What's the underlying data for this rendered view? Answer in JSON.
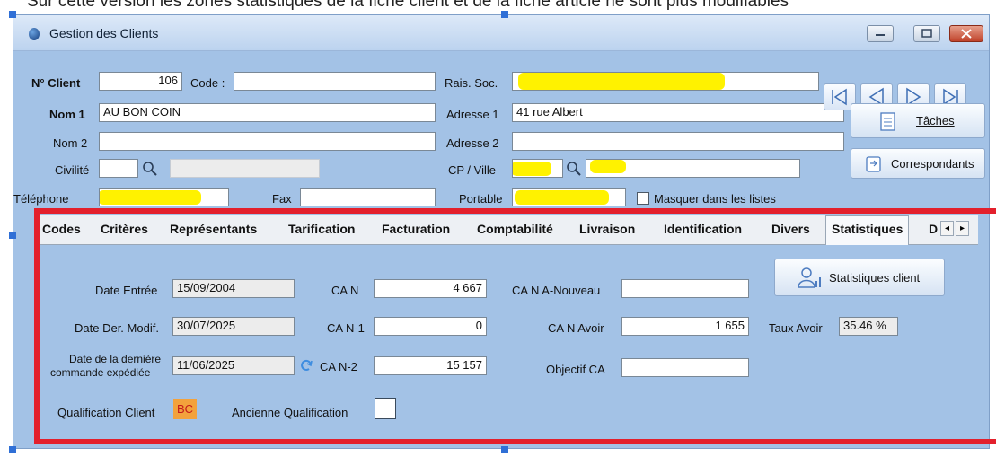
{
  "top_caption": "Sur cette version les zones statistiques de la fiche client et de la fiche article ne sont plus modifiables",
  "window": {
    "title": "Gestion des Clients",
    "buttons": [
      "minimize",
      "maximize",
      "close"
    ]
  },
  "client": {
    "num_label": "N° Client",
    "num_value": "106",
    "code_label": "Code :",
    "code_value": "",
    "nom1_label": "Nom 1",
    "nom1_value": "AU BON COIN",
    "nom2_label": "Nom 2",
    "nom2_value": "",
    "civilite_label": "Civilité",
    "civilite_value": "",
    "telephone_label": "Téléphone",
    "fax_label": "Fax",
    "fax_value": "",
    "rais_soc_label": "Rais. Soc.",
    "adresse1_label": "Adresse 1",
    "adresse1_value": "41 rue Albert",
    "adresse2_label": "Adresse 2",
    "adresse2_value": "",
    "cpville_label": "CP / Ville",
    "portable_label": "Portable",
    "masquer_label": "Masquer dans les listes"
  },
  "side_buttons": {
    "taches": "Tâches",
    "correspondants": "Correspondants"
  },
  "tabs": [
    "Codes",
    "Critères",
    "Représentants",
    "Tarification",
    "Facturation",
    "Comptabilité",
    "Livraison",
    "Identification",
    "Divers",
    "Statistiques",
    "D"
  ],
  "active_tab": "Statistiques",
  "stats": {
    "date_entree_label": "Date Entrée",
    "date_entree": "15/09/2004",
    "date_modif_label": "Date Der. Modif.",
    "date_modif": "30/07/2025",
    "derniere_cmd_label_1": "Date de la dernière",
    "derniere_cmd_label_2": "commande expédiée",
    "derniere_cmd": "11/06/2025",
    "ca_n_label": "CA N",
    "ca_n": "4 667",
    "ca_n1_label": "CA N-1",
    "ca_n1": "0",
    "ca_n2_label": "CA N-2",
    "ca_n2": "15 157",
    "ca_a_nouveau_label": "CA N A-Nouveau",
    "ca_a_nouveau": "",
    "ca_avoir_label": "CA N Avoir",
    "ca_avoir": "1 655",
    "objectif_label": "Objectif CA",
    "objectif": "",
    "taux_avoir_label": "Taux Avoir",
    "taux_avoir": "35.46 %",
    "stats_button": "Statistiques client",
    "qualif_label": "Qualification Client",
    "qualif_value": "BC",
    "ancienne_label": "Ancienne Qualification"
  },
  "colors": {
    "window_bg": "#a3c2e6",
    "highlight": "#fff200",
    "annotation_red": "#e3202c",
    "qualif_badge": "#f3a23c"
  }
}
